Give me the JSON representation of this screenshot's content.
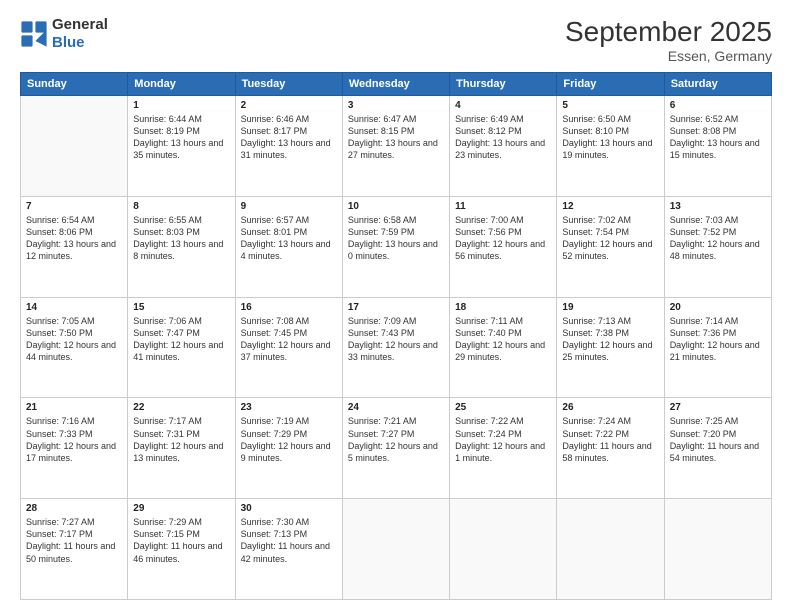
{
  "header": {
    "logo": {
      "general": "General",
      "blue": "Blue"
    },
    "title": "September 2025",
    "location": "Essen, Germany"
  },
  "calendar": {
    "days_of_week": [
      "Sunday",
      "Monday",
      "Tuesday",
      "Wednesday",
      "Thursday",
      "Friday",
      "Saturday"
    ],
    "weeks": [
      [
        {
          "day": "",
          "info": ""
        },
        {
          "day": "1",
          "info": "Sunrise: 6:44 AM\nSunset: 8:19 PM\nDaylight: 13 hours\nand 35 minutes."
        },
        {
          "day": "2",
          "info": "Sunrise: 6:46 AM\nSunset: 8:17 PM\nDaylight: 13 hours\nand 31 minutes."
        },
        {
          "day": "3",
          "info": "Sunrise: 6:47 AM\nSunset: 8:15 PM\nDaylight: 13 hours\nand 27 minutes."
        },
        {
          "day": "4",
          "info": "Sunrise: 6:49 AM\nSunset: 8:12 PM\nDaylight: 13 hours\nand 23 minutes."
        },
        {
          "day": "5",
          "info": "Sunrise: 6:50 AM\nSunset: 8:10 PM\nDaylight: 13 hours\nand 19 minutes."
        },
        {
          "day": "6",
          "info": "Sunrise: 6:52 AM\nSunset: 8:08 PM\nDaylight: 13 hours\nand 15 minutes."
        }
      ],
      [
        {
          "day": "7",
          "info": "Sunrise: 6:54 AM\nSunset: 8:06 PM\nDaylight: 13 hours\nand 12 minutes."
        },
        {
          "day": "8",
          "info": "Sunrise: 6:55 AM\nSunset: 8:03 PM\nDaylight: 13 hours\nand 8 minutes."
        },
        {
          "day": "9",
          "info": "Sunrise: 6:57 AM\nSunset: 8:01 PM\nDaylight: 13 hours\nand 4 minutes."
        },
        {
          "day": "10",
          "info": "Sunrise: 6:58 AM\nSunset: 7:59 PM\nDaylight: 13 hours\nand 0 minutes."
        },
        {
          "day": "11",
          "info": "Sunrise: 7:00 AM\nSunset: 7:56 PM\nDaylight: 12 hours\nand 56 minutes."
        },
        {
          "day": "12",
          "info": "Sunrise: 7:02 AM\nSunset: 7:54 PM\nDaylight: 12 hours\nand 52 minutes."
        },
        {
          "day": "13",
          "info": "Sunrise: 7:03 AM\nSunset: 7:52 PM\nDaylight: 12 hours\nand 48 minutes."
        }
      ],
      [
        {
          "day": "14",
          "info": "Sunrise: 7:05 AM\nSunset: 7:50 PM\nDaylight: 12 hours\nand 44 minutes."
        },
        {
          "day": "15",
          "info": "Sunrise: 7:06 AM\nSunset: 7:47 PM\nDaylight: 12 hours\nand 41 minutes."
        },
        {
          "day": "16",
          "info": "Sunrise: 7:08 AM\nSunset: 7:45 PM\nDaylight: 12 hours\nand 37 minutes."
        },
        {
          "day": "17",
          "info": "Sunrise: 7:09 AM\nSunset: 7:43 PM\nDaylight: 12 hours\nand 33 minutes."
        },
        {
          "day": "18",
          "info": "Sunrise: 7:11 AM\nSunset: 7:40 PM\nDaylight: 12 hours\nand 29 minutes."
        },
        {
          "day": "19",
          "info": "Sunrise: 7:13 AM\nSunset: 7:38 PM\nDaylight: 12 hours\nand 25 minutes."
        },
        {
          "day": "20",
          "info": "Sunrise: 7:14 AM\nSunset: 7:36 PM\nDaylight: 12 hours\nand 21 minutes."
        }
      ],
      [
        {
          "day": "21",
          "info": "Sunrise: 7:16 AM\nSunset: 7:33 PM\nDaylight: 12 hours\nand 17 minutes."
        },
        {
          "day": "22",
          "info": "Sunrise: 7:17 AM\nSunset: 7:31 PM\nDaylight: 12 hours\nand 13 minutes."
        },
        {
          "day": "23",
          "info": "Sunrise: 7:19 AM\nSunset: 7:29 PM\nDaylight: 12 hours\nand 9 minutes."
        },
        {
          "day": "24",
          "info": "Sunrise: 7:21 AM\nSunset: 7:27 PM\nDaylight: 12 hours\nand 5 minutes."
        },
        {
          "day": "25",
          "info": "Sunrise: 7:22 AM\nSunset: 7:24 PM\nDaylight: 12 hours\nand 1 minute."
        },
        {
          "day": "26",
          "info": "Sunrise: 7:24 AM\nSunset: 7:22 PM\nDaylight: 11 hours\nand 58 minutes."
        },
        {
          "day": "27",
          "info": "Sunrise: 7:25 AM\nSunset: 7:20 PM\nDaylight: 11 hours\nand 54 minutes."
        }
      ],
      [
        {
          "day": "28",
          "info": "Sunrise: 7:27 AM\nSunset: 7:17 PM\nDaylight: 11 hours\nand 50 minutes."
        },
        {
          "day": "29",
          "info": "Sunrise: 7:29 AM\nSunset: 7:15 PM\nDaylight: 11 hours\nand 46 minutes."
        },
        {
          "day": "30",
          "info": "Sunrise: 7:30 AM\nSunset: 7:13 PM\nDaylight: 11 hours\nand 42 minutes."
        },
        {
          "day": "",
          "info": ""
        },
        {
          "day": "",
          "info": ""
        },
        {
          "day": "",
          "info": ""
        },
        {
          "day": "",
          "info": ""
        }
      ]
    ]
  }
}
